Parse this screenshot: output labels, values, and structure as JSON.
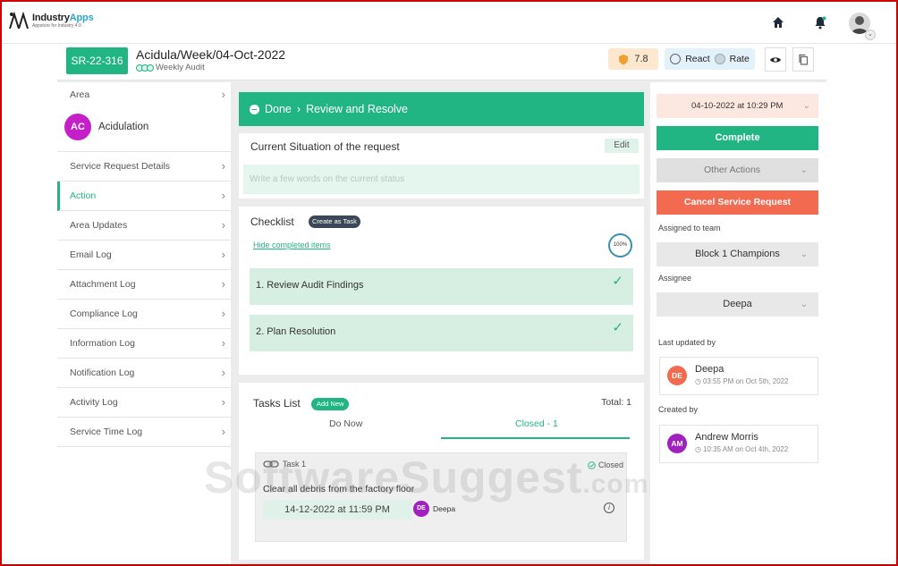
{
  "app": {
    "name_prefix": "Industry",
    "name_suffix": "Apps",
    "tagline": "Appstore for Industry 4.0"
  },
  "header": {
    "sr_id": "SR-22-316",
    "title": "Acidula/Week/04-Oct-2022",
    "subtitle": "Weekly Audit",
    "score": "7.8",
    "react_label": "React",
    "rate_label": "Rate"
  },
  "sidebar": {
    "area_label": "Area",
    "area_avatar": "AC",
    "area_name": "Acidulation",
    "items": [
      {
        "label": "Service Request Details"
      },
      {
        "label": "Action"
      },
      {
        "label": "Area Updates"
      },
      {
        "label": "Email Log"
      },
      {
        "label": "Attachment Log"
      },
      {
        "label": "Compliance Log"
      },
      {
        "label": "Information Log"
      },
      {
        "label": "Notification Log"
      },
      {
        "label": "Activity Log"
      },
      {
        "label": "Service Time Log"
      }
    ]
  },
  "status": {
    "from": "Done",
    "to": "Review and Resolve"
  },
  "situation": {
    "title": "Current Situation of the request",
    "edit_label": "Edit",
    "placeholder": "Write a few words on the current status"
  },
  "checklist": {
    "title": "Checklist",
    "create_task_label": "Create as Task",
    "hide_link": "Hide completed items",
    "progress_label": "100%",
    "progress": 1.0,
    "items": [
      {
        "label": "1. Review Audit Findings",
        "done": true
      },
      {
        "label": "2. Plan Resolution",
        "done": true
      }
    ]
  },
  "tasks": {
    "title": "Tasks List",
    "add_label": "Add New",
    "total": "Total: 1",
    "tab_do_now": "Do Now",
    "tab_closed": "Closed - 1",
    "task": {
      "tag": "Task 1",
      "status": "Closed",
      "description": "Clear all debris from the factory floor",
      "due": "14-12-2022 at 11:59 PM",
      "assignee_initials": "DE",
      "assignee": "Deepa"
    }
  },
  "right": {
    "date": "04-10-2022 at 10:29 PM",
    "complete_label": "Complete",
    "other_actions_label": "Other Actions",
    "cancel_label": "Cancel Service Request",
    "team_label": "Assigned to team",
    "team_value": "Block 1 Champions",
    "assignee_label": "Assignee",
    "assignee_value": "Deepa",
    "last_updated_label": "Last updated by",
    "last_updated": {
      "initials": "DE",
      "name": "Deepa",
      "time": "03:55 PM on Oct 5th, 2022"
    },
    "created_label": "Created by",
    "created": {
      "initials": "AM",
      "name": "Andrew Morris",
      "time": "10:35 AM on Oct 4th, 2022"
    }
  },
  "watermark": {
    "main": "SoftwareSuggest",
    "suffix": ".com"
  },
  "colors": {
    "accent": "#22b584",
    "danger": "#f26b50",
    "avatar_purple": "#c51fc9",
    "border_red": "#cc0000"
  }
}
